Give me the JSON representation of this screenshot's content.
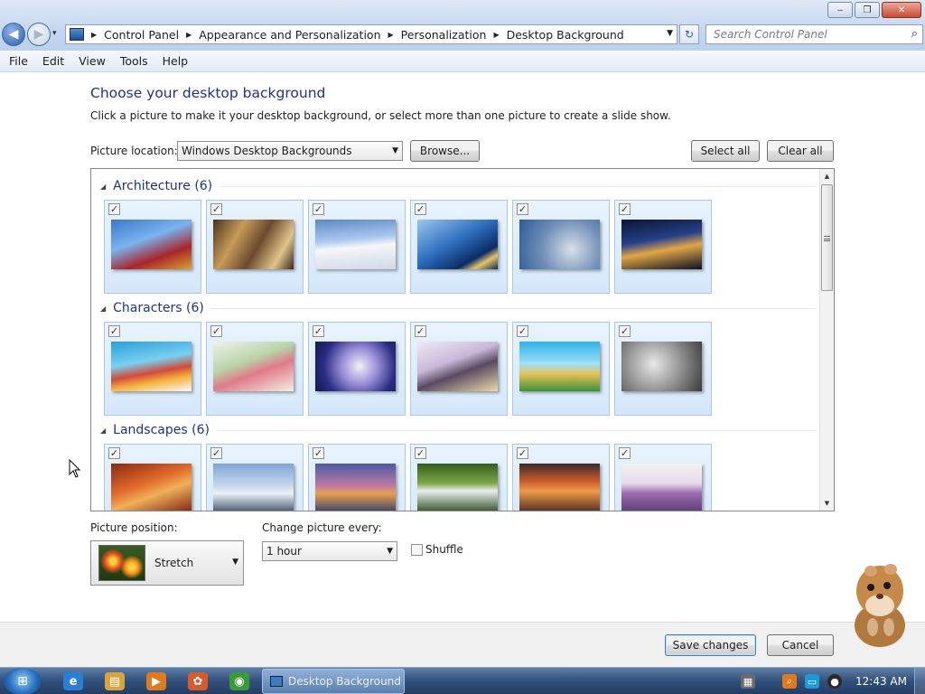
{
  "window": {
    "controls": {
      "minimize": "‒",
      "maximize": "❐",
      "close": "✕"
    }
  },
  "nav": {
    "back_icon": "◀",
    "forward_icon": "▶",
    "dropdown_icon": "▾"
  },
  "address": {
    "crumbs": [
      "Control Panel",
      "Appearance and Personalization",
      "Personalization",
      "Desktop Background"
    ],
    "refresh_icon": "↻"
  },
  "search": {
    "placeholder": "Search Control Panel",
    "icon": "⌕"
  },
  "menu": [
    "File",
    "Edit",
    "View",
    "Tools",
    "Help"
  ],
  "page": {
    "title": "Choose your desktop background",
    "subtitle": "Click a picture to make it your desktop background, or select more than one picture to create a slide show.",
    "location_label": "Picture location:",
    "location_value": "Windows Desktop Backgrounds",
    "browse_label": "Browse...",
    "select_all_label": "Select all",
    "clear_all_label": "Clear all"
  },
  "groups": [
    {
      "title": "Architecture (6)",
      "items": [
        {
          "checked": true,
          "bg": "linear-gradient(160deg,#3c77c8,#79b4ee 40%,#a8252a 70%,#d9a030)"
        },
        {
          "checked": true,
          "bg": "linear-gradient(120deg,#4a3320,#c79b58 30%,#6b4a2c 55%,#e0c48a 80%,#3b2a18)"
        },
        {
          "checked": true,
          "bg": "linear-gradient(175deg,#5d88c4,#aac8ee 40%,#f4f6f9 55%,#cfd8e6)"
        },
        {
          "checked": true,
          "bg": "linear-gradient(150deg,#9cc6ef,#2f6fbf 45%,#0b2c66 75%,#e3c36a 85%,#102a50)"
        },
        {
          "checked": true,
          "bg": "radial-gradient(circle at 65% 60%,#d8dfe8,#6f8fb8 50%,#2d5a9a)"
        },
        {
          "checked": true,
          "bg": "linear-gradient(170deg,#0b1530,#25408a 40%,#e1a644 60%,#0a0f25)"
        }
      ]
    },
    {
      "title": "Characters (6)",
      "items": [
        {
          "checked": true,
          "bg": "linear-gradient(170deg,#2c9fd8,#78d0f0 40%,#d24b3a 60%,#f4b13a 75%,#fbfbfb)"
        },
        {
          "checked": true,
          "bg": "linear-gradient(160deg,#eef3ee,#b9d3a8 40%,#e07a8a 60%,#f3efe2)"
        },
        {
          "checked": true,
          "bg": "radial-gradient(circle at 55% 50%,#f0f0f6,#9a8fd8 35%,#2a2c84 70%,#141850)"
        },
        {
          "checked": true,
          "bg": "linear-gradient(160deg,#efe9f3,#c9b8d9 40%,#5a4a62 60%,#e9d9a8)"
        },
        {
          "checked": true,
          "bg": "linear-gradient(180deg,#2fb1e8,#9fe0f5 45%,#e8c058 65%,#3b8f3a)"
        },
        {
          "checked": true,
          "bg": "radial-gradient(circle at 40% 45%,#e8e8e8,#9a9a9a 45%,#3a3a3a)"
        }
      ]
    },
    {
      "title": "Landscapes (6)",
      "items": [
        {
          "checked": true,
          "bg": "linear-gradient(160deg,#8a2a12,#e06a2a 40%,#f0b05a 60%,#7a1e0e)"
        },
        {
          "checked": true,
          "bg": "linear-gradient(180deg,#7fa6d6,#c9d8ea 45%,#e9f1f7 60%,#3a4c66)"
        },
        {
          "checked": true,
          "bg": "linear-gradient(180deg,#4a5aa8,#c07aa0 45%,#e7a050 60%,#2f3e6e)"
        },
        {
          "checked": true,
          "bg": "linear-gradient(180deg,#355e1c,#7fa84a 40%,#e9eef0 55%,#2e4a18)"
        },
        {
          "checked": true,
          "bg": "linear-gradient(180deg,#3c2a2a,#c85a2a 35%,#f09a4a 55%,#4a2a1e)"
        },
        {
          "checked": true,
          "bg": "linear-gradient(180deg,#f3f1ee,#e6dbe8 40%,#9a6ab0 60%,#5a3a70)"
        }
      ]
    }
  ],
  "position": {
    "label": "Picture position:",
    "value": "Stretch"
  },
  "interval": {
    "label": "Change picture every:",
    "value": "1 hour"
  },
  "shuffle": {
    "label": "Shuffle",
    "checked": false
  },
  "footer": {
    "save_label": "Save changes",
    "cancel_label": "Cancel"
  },
  "taskbar": {
    "start_icon": "⊞",
    "pinned": [
      {
        "name": "ie-icon",
        "glyph": "e",
        "color": "#2a7fd4"
      },
      {
        "name": "explorer-icon",
        "glyph": "▤",
        "color": "#d9a53a"
      },
      {
        "name": "media-player-icon",
        "glyph": "▶",
        "color": "#e07a1e"
      },
      {
        "name": "paint-icon",
        "glyph": "✿",
        "color": "#d95a2a"
      },
      {
        "name": "chrome-icon",
        "glyph": "◉",
        "color": "#3a9a3a"
      }
    ],
    "active_task": "Desktop Background",
    "clock": "12:43 AM"
  }
}
